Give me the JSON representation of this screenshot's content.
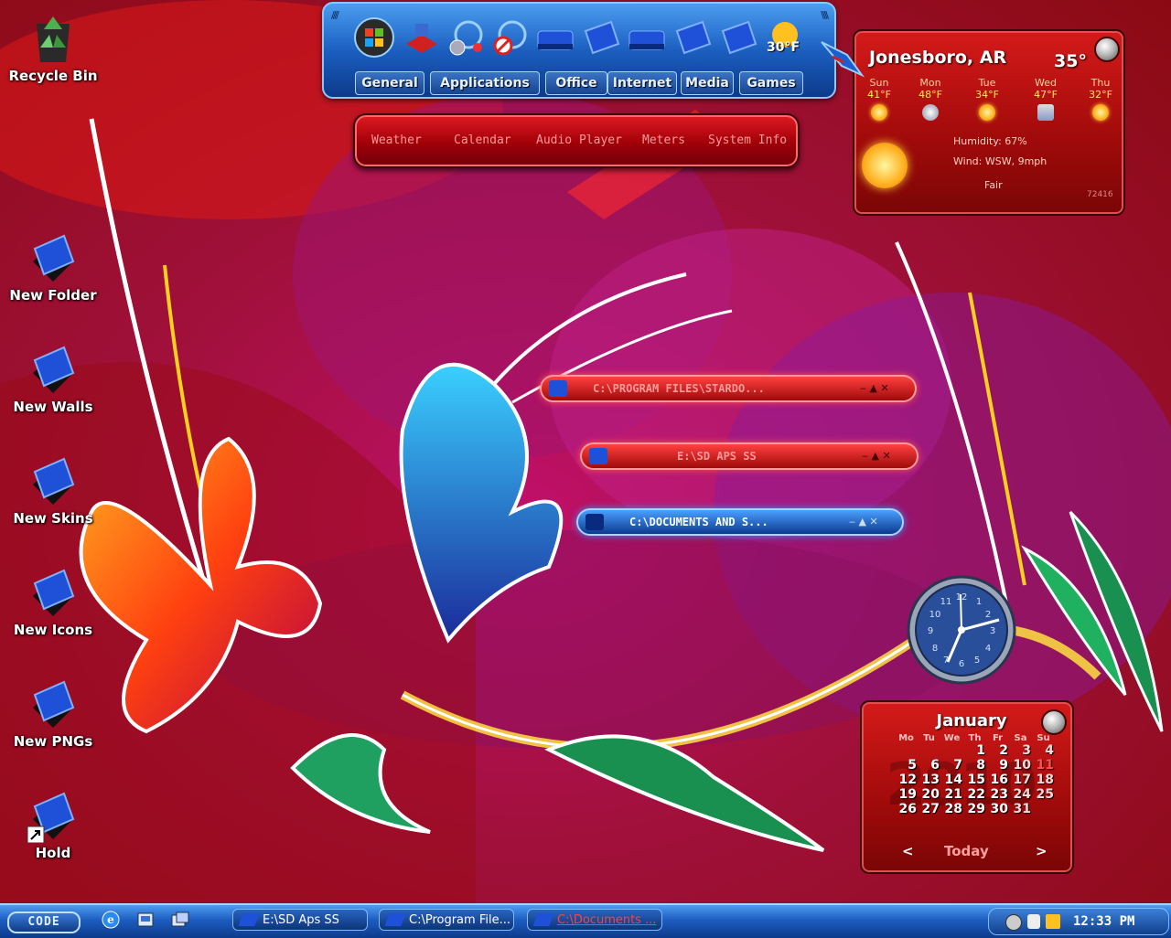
{
  "desktop": {
    "icons": [
      {
        "label": "Recycle Bin"
      },
      {
        "label": "New Folder"
      },
      {
        "label": "New Walls"
      },
      {
        "label": "New Skins"
      },
      {
        "label": "New Icons"
      },
      {
        "label": "New PNGs"
      },
      {
        "label": "Hold"
      }
    ]
  },
  "dock": {
    "weather_temp": "30°F",
    "tabs": [
      "General",
      "Applications",
      "Office",
      "Internet",
      "Media",
      "Games"
    ],
    "icons": [
      "windows-orb-icon",
      "network-icon",
      "media-settings-icon",
      "media-blocked-icon",
      "drive-icon",
      "folder-icon",
      "drive-icon",
      "folder-icon",
      "folder-icon",
      "sun-icon"
    ]
  },
  "menubar": {
    "items": [
      "Weather",
      "Calendar",
      "Audio Player",
      "Meters",
      "System Info"
    ]
  },
  "weather": {
    "city": "Jonesboro, AR",
    "current_temp": "35°",
    "forecast": [
      {
        "day": "Sun",
        "temp": "41°F"
      },
      {
        "day": "Mon",
        "temp": "48°F"
      },
      {
        "day": "Tue",
        "temp": "34°F"
      },
      {
        "day": "Wed",
        "temp": "47°F"
      },
      {
        "day": "Thu",
        "temp": "32°F"
      }
    ],
    "humidity": "Humidity: 67%",
    "wind": "Wind: WSW, 9mph",
    "condition": "Fair",
    "zip": "72416"
  },
  "explorer_bars": [
    {
      "path": "C:\\PROGRAM FILES\\STARDO...",
      "theme": "red"
    },
    {
      "path": "E:\\SD APS SS",
      "theme": "red"
    },
    {
      "path": "C:\\DOCUMENTS AND S...",
      "theme": "blue"
    }
  ],
  "calendar": {
    "month": "January",
    "year_watermark": "2010",
    "weekdays": [
      "Mo",
      "Tu",
      "We",
      "Th",
      "Fr",
      "Sa",
      "Su"
    ],
    "weeks": [
      [
        "",
        "",
        "",
        "1",
        "2",
        "3",
        "4"
      ],
      [
        "5",
        "6",
        "7",
        "8",
        "9",
        "10",
        "11"
      ],
      [
        "12",
        "13",
        "14",
        "15",
        "16",
        "17",
        "18"
      ],
      [
        "19",
        "20",
        "21",
        "22",
        "23",
        "24",
        "25"
      ],
      [
        "26",
        "27",
        "28",
        "29",
        "30",
        "31",
        ""
      ]
    ],
    "today_day": "11",
    "prev_label": "<",
    "today_label": "Today",
    "next_label": ">"
  },
  "taskbar": {
    "start_label": "CODE",
    "tasks": [
      {
        "label": "E:\\SD Aps SS"
      },
      {
        "label": "C:\\Program File..."
      },
      {
        "label": "C:\\Documents ..."
      }
    ],
    "clock": "12:33 PM"
  },
  "colors": {
    "accent_blue": "#1d5dc0",
    "accent_red": "#c01016"
  }
}
